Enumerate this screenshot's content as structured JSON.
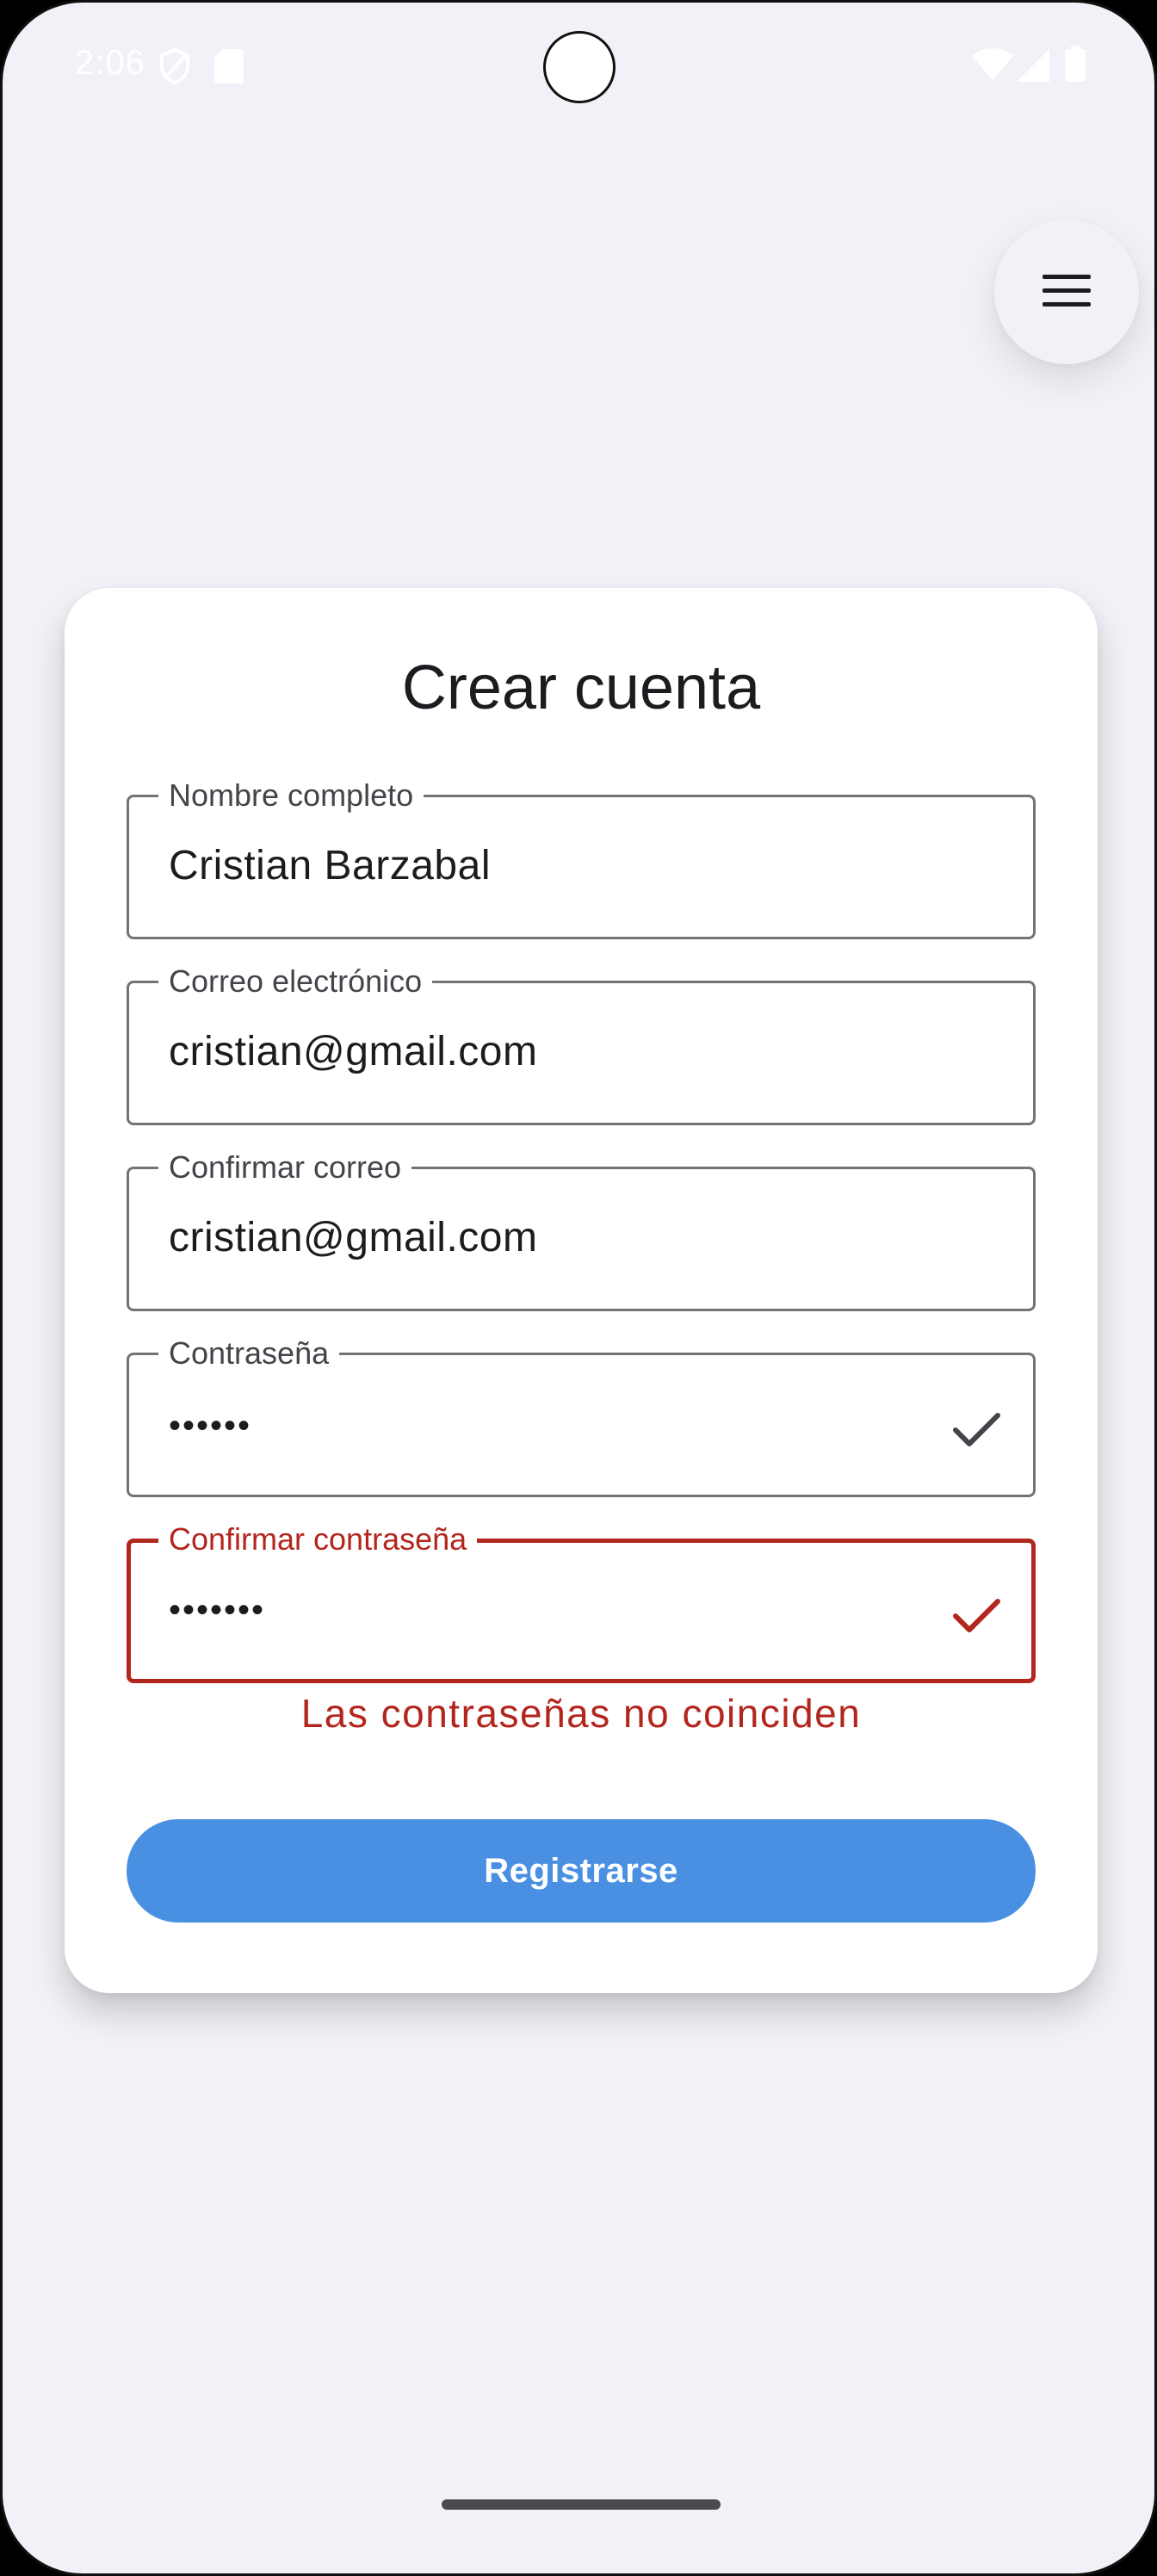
{
  "status_bar": {
    "time": "2:06",
    "icons": [
      "vpn-shield-icon",
      "sd-card-icon",
      "wifi-icon",
      "signal-icon",
      "battery-icon"
    ]
  },
  "menu_button": {
    "icon": "hamburger-menu-icon"
  },
  "form": {
    "title": "Crear cuenta",
    "fields": [
      {
        "label": "Nombre completo",
        "value": "Cristian Barzabal"
      },
      {
        "label": "Correo electrónico",
        "value": "cristian@gmail.com"
      },
      {
        "label": "Confirmar correo",
        "value": "cristian@gmail.com"
      },
      {
        "label": "Contraseña",
        "value": "••••••",
        "icon": "check-icon"
      },
      {
        "label": "Confirmar contraseña",
        "value": "•••••••",
        "icon": "check-icon",
        "state": "error"
      }
    ],
    "error_message": "Las contraseñas no coinciden",
    "submit_label": "Registrarse"
  },
  "colors": {
    "background": "#f1f2f7",
    "card": "#ffffff",
    "primary_button": "#4a90e2",
    "error": "#b3261e",
    "outline": "#74737a"
  }
}
